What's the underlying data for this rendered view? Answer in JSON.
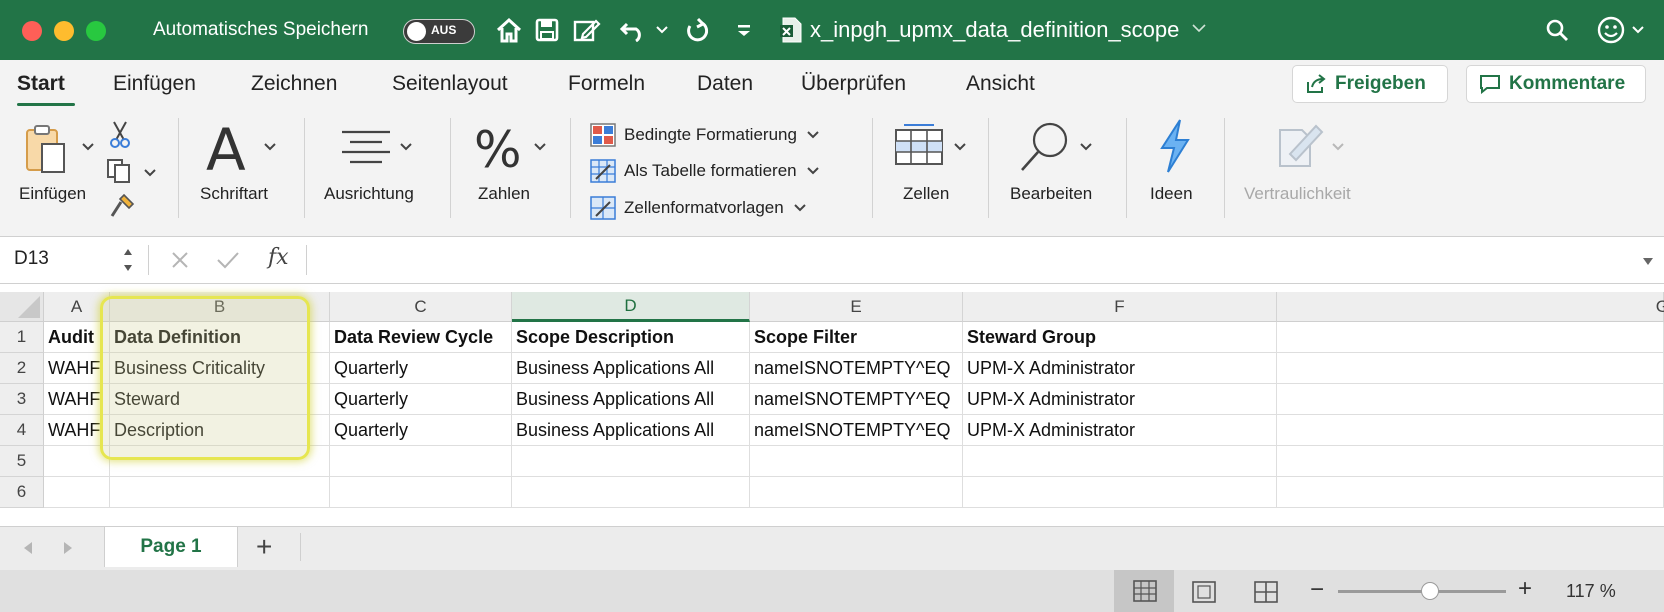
{
  "titlebar": {
    "autosave_label": "Automatisches Speichern",
    "autosave_state": "AUS",
    "doc_title": "x_inpgh_upmx_data_definition_scope"
  },
  "ribbon": {
    "tabs": [
      "Start",
      "Einfügen",
      "Zeichnen",
      "Seitenlayout",
      "Formeln",
      "Daten",
      "Überprüfen",
      "Ansicht"
    ],
    "share_label": "Freigeben",
    "comments_label": "Kommentare",
    "groups": {
      "paste": "Einfügen",
      "font": "Schriftart",
      "alignment": "Ausrichtung",
      "number": "Zahlen",
      "cells": "Zellen",
      "edit": "Bearbeiten",
      "ideas": "Ideen",
      "sensitivity": "Vertraulichkeit"
    },
    "styles": {
      "conditional": "Bedingte Formatierung",
      "table": "Als Tabelle formatieren",
      "cellstyles": "Zellenformatvorlagen"
    }
  },
  "formulabar": {
    "namebox": "D13",
    "fx": "fx"
  },
  "grid": {
    "columns": [
      "A",
      "B",
      "C",
      "D",
      "E",
      "F",
      "G"
    ],
    "rows": [
      "1",
      "2",
      "3",
      "4",
      "5",
      "6"
    ],
    "header_row": [
      "Audit",
      "Data Definition",
      "Data Review Cycle",
      "Scope Description",
      "Scope Filter",
      "Steward Group"
    ],
    "data_rows": [
      [
        "WAHF",
        "Business Criticality",
        "Quarterly",
        "Business Applications All",
        "nameISNOTEMPTY^EQ",
        "UPM-X Administrator"
      ],
      [
        "WAHF",
        "Steward",
        "Quarterly",
        "Business Applications All",
        "nameISNOTEMPTY^EQ",
        "UPM-X Administrator"
      ],
      [
        "WAHF",
        "Description",
        "Quarterly",
        "Business Applications All",
        "nameISNOTEMPTY^EQ",
        "UPM-X Administrator"
      ]
    ]
  },
  "sheets": {
    "active": "Page 1",
    "add": "+"
  },
  "status": {
    "zoom": "117 %",
    "zoom_level": 0.55
  },
  "colors": {
    "accent": "#227447",
    "highlight": "#e6e651"
  }
}
